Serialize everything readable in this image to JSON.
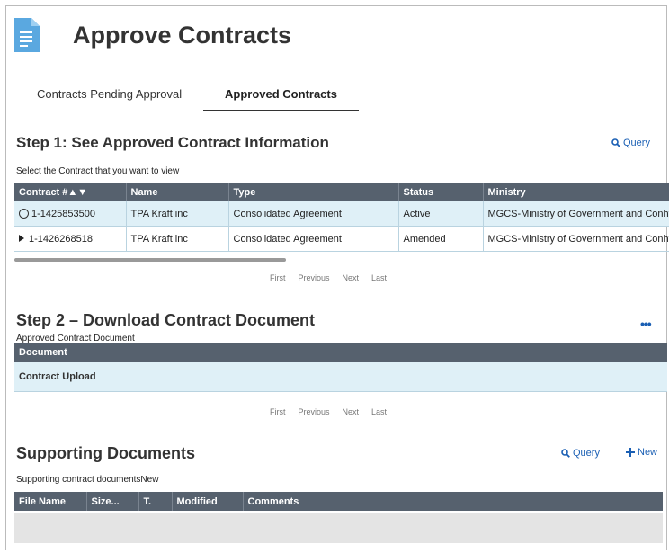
{
  "page": {
    "title": "Approve Contracts",
    "icon": "document-icon"
  },
  "tabs": [
    {
      "label": "Contracts Pending Approval",
      "active": false
    },
    {
      "label": "Approved Contracts",
      "active": true
    }
  ],
  "step1": {
    "heading": "Step 1: See Approved Contract Information",
    "query_label": "Query",
    "instruction": "Select the Contract that you want to view",
    "columns": [
      "Contract #▲▼",
      "Name",
      "Type",
      "Status",
      "Ministry"
    ],
    "rows": [
      {
        "contract": "1-1425853500",
        "name": "TPA Kraft inc",
        "type": "Consolidated Agreement",
        "status": "Active",
        "ministry": "MGCS-Ministry of Government and Conht"
      },
      {
        "contract": "1-1426268518",
        "name": "TPA Kraft inc",
        "type": "Consolidated Agreement",
        "status": "Amended",
        "ministry": "MGCS-Ministry of Government and Conht"
      }
    ],
    "pager": [
      "First",
      "Previous",
      "Next",
      "Last"
    ]
  },
  "step2": {
    "heading": "Step 2 – Download Contract Document",
    "subtitle": "Approved Contract Document",
    "more_label": "•••",
    "column": "Document",
    "row": "Contract Upload",
    "pager": [
      "First",
      "Previous",
      "Next",
      "Last"
    ]
  },
  "supporting": {
    "heading": "Supporting Documents",
    "query_label": "Query",
    "new_label": "New",
    "subtitle": "Supporting contract documentsNew",
    "columns": [
      "File Name",
      "Size...",
      "T.",
      "Modified",
      "Comments"
    ]
  },
  "colors": {
    "header_bg": "#56616e",
    "selected_row": "#dff0f7",
    "link": "#1a5fb4",
    "icon": "#5aa8e0"
  }
}
